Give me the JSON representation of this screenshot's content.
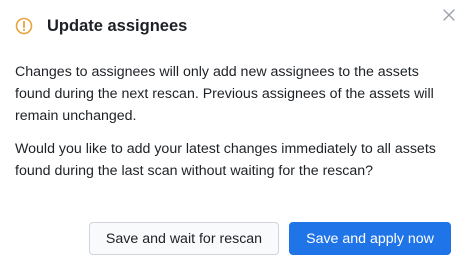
{
  "dialog": {
    "title": "Update assignees",
    "close_icon": "close-icon",
    "warning_icon": "warning-circle-icon",
    "paragraph1": "Changes to assignees will only add new assignees to the assets found during the next rescan. Previous assignees of the assets will remain unchanged.",
    "paragraph2": "Would you like to add your latest changes immediately to all assets found during the last scan without waiting for the rescan?",
    "secondary_button": "Save and wait for rescan",
    "primary_button": "Save and apply now"
  },
  "colors": {
    "accent": "#1f74e8",
    "warning": "#e8a33a",
    "text": "#1d2126",
    "close_icon": "#9aa1ab"
  }
}
